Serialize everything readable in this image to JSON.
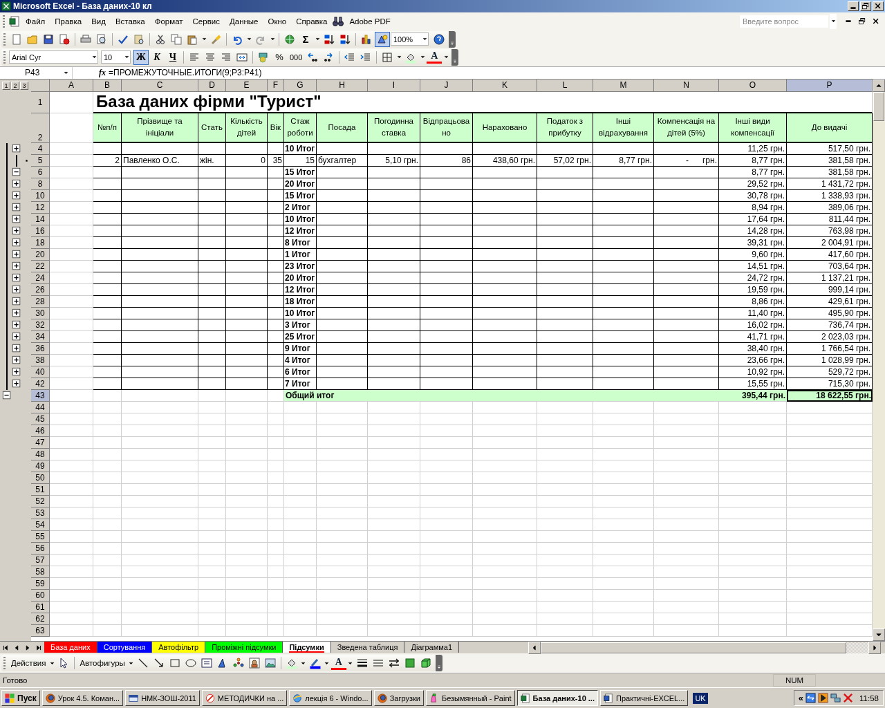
{
  "window": {
    "title": "Microsoft Excel - База даних-10 кл"
  },
  "menu": {
    "items": [
      "Файл",
      "Правка",
      "Вид",
      "Вставка",
      "Формат",
      "Сервис",
      "Данные",
      "Окно",
      "Справка"
    ],
    "adobe": "Adobe PDF",
    "help_placeholder": "Введите вопрос"
  },
  "toolbar": {
    "sum": "Σ",
    "zoom": "100%",
    "font": "Arial Cyr",
    "size": "10",
    "bold": "Ж",
    "italic": "К",
    "underline": "Ч",
    "bold_on": true,
    "percent": "%",
    "thousands": "000",
    "font_color": "A"
  },
  "formula_bar": {
    "name_box": "P43",
    "fx": "fx",
    "formula": "=ПРОМЕЖУТОЧНЫЕ.ИТОГИ(9;P3:P41)"
  },
  "sheet": {
    "outline_levels": [
      "1",
      "2",
      "3"
    ],
    "columns": [
      {
        "label": "A",
        "selected": false
      },
      {
        "label": "B",
        "selected": false
      },
      {
        "label": "C",
        "selected": false
      },
      {
        "label": "D",
        "selected": false
      },
      {
        "label": "E",
        "selected": false
      },
      {
        "label": "F",
        "selected": false
      },
      {
        "label": "G",
        "selected": false
      },
      {
        "label": "H",
        "selected": false
      },
      {
        "label": "I",
        "selected": false
      },
      {
        "label": "J",
        "selected": false
      },
      {
        "label": "K",
        "selected": false
      },
      {
        "label": "L",
        "selected": false
      },
      {
        "label": "M",
        "selected": false
      },
      {
        "label": "N",
        "selected": false
      },
      {
        "label": "O",
        "selected": false
      },
      {
        "label": "P",
        "selected": true
      }
    ],
    "rows": [
      {
        "label": "1",
        "kind": "title",
        "selected": false,
        "title": "База даних фірми \"Турист\""
      },
      {
        "label": "2",
        "kind": "header",
        "selected": false,
        "cells": [
          "№п/п",
          "Прізвище та ініціали",
          "Стать",
          "Кількість дітей",
          "Вік",
          "Стаж роботи",
          "Посада",
          "Погодинна ставка",
          "Відпрацьовано",
          "Нараховано",
          "Податок з прибутку",
          "Інші відрахування",
          "Компенсація на дітей (5%)",
          "Інші види компенсації",
          "До видачі"
        ]
      },
      {
        "label": "4",
        "kind": "subtotal",
        "selected": false,
        "expanded": false,
        "group": "10 Итог",
        "compensation": "11,25 грн.",
        "payout": "517,50 грн."
      },
      {
        "label": "5",
        "kind": "data",
        "selected": false,
        "cells": [
          "2",
          "Павленко О.С.",
          "жін.",
          "0",
          "35",
          "15",
          "бухгалтер",
          "5,10 грн.",
          "86",
          "438,60 грн.",
          "57,02 грн.",
          "8,77 грн.",
          "-      грн.",
          "8,77 грн.",
          "381,58 грн."
        ]
      },
      {
        "label": "6",
        "kind": "subtotal",
        "selected": false,
        "expanded": true,
        "group": "15 Итог",
        "compensation": "8,77 грн.",
        "payout": "381,58 грн."
      },
      {
        "label": "8",
        "kind": "subtotal",
        "selected": false,
        "expanded": false,
        "group": "20 Итог",
        "compensation": "29,52 грн.",
        "payout": "1 431,72 грн."
      },
      {
        "label": "10",
        "kind": "subtotal",
        "selected": false,
        "expanded": false,
        "group": "15 Итог",
        "compensation": "30,78 грн.",
        "payout": "1 338,93 грн."
      },
      {
        "label": "12",
        "kind": "subtotal",
        "selected": false,
        "expanded": false,
        "group": "2 Итог",
        "compensation": "8,94 грн.",
        "payout": "389,06 грн."
      },
      {
        "label": "14",
        "kind": "subtotal",
        "selected": false,
        "expanded": false,
        "group": "10 Итог",
        "compensation": "17,64 грн.",
        "payout": "811,44 грн."
      },
      {
        "label": "16",
        "kind": "subtotal",
        "selected": false,
        "expanded": false,
        "group": "12 Итог",
        "compensation": "14,28 грн.",
        "payout": "763,98 грн."
      },
      {
        "label": "18",
        "kind": "subtotal",
        "selected": false,
        "expanded": false,
        "group": "8 Итог",
        "compensation": "39,31 грн.",
        "payout": "2 004,91 грн."
      },
      {
        "label": "20",
        "kind": "subtotal",
        "selected": false,
        "expanded": false,
        "group": "1 Итог",
        "compensation": "9,60 грн.",
        "payout": "417,60 грн."
      },
      {
        "label": "22",
        "kind": "subtotal",
        "selected": false,
        "expanded": false,
        "group": "23 Итог",
        "compensation": "14,51 грн.",
        "payout": "703,64 грн."
      },
      {
        "label": "24",
        "kind": "subtotal",
        "selected": false,
        "expanded": false,
        "group": "20 Итог",
        "compensation": "24,72 грн.",
        "payout": "1 137,21 грн."
      },
      {
        "label": "26",
        "kind": "subtotal",
        "selected": false,
        "expanded": false,
        "group": "12 Итог",
        "compensation": "19,59 грн.",
        "payout": "999,14 грн."
      },
      {
        "label": "28",
        "kind": "subtotal",
        "selected": false,
        "expanded": false,
        "group": "18 Итог",
        "compensation": "8,86 грн.",
        "payout": "429,61 грн."
      },
      {
        "label": "30",
        "kind": "subtotal",
        "selected": false,
        "expanded": false,
        "group": "10 Итог",
        "compensation": "11,40 грн.",
        "payout": "495,90 грн."
      },
      {
        "label": "32",
        "kind": "subtotal",
        "selected": false,
        "expanded": false,
        "group": "3 Итог",
        "compensation": "16,02 грн.",
        "payout": "736,74 грн."
      },
      {
        "label": "34",
        "kind": "subtotal",
        "selected": false,
        "expanded": false,
        "group": "25 Итог",
        "compensation": "41,71 грн.",
        "payout": "2 023,03 грн."
      },
      {
        "label": "36",
        "kind": "subtotal",
        "selected": false,
        "expanded": false,
        "group": "9 Итог",
        "compensation": "38,40 грн.",
        "payout": "1 766,54 грн."
      },
      {
        "label": "38",
        "kind": "subtotal",
        "selected": false,
        "expanded": false,
        "group": "4 Итог",
        "compensation": "23,66 грн.",
        "payout": "1 028,99 грн."
      },
      {
        "label": "40",
        "kind": "subtotal",
        "selected": false,
        "expanded": false,
        "group": "6 Итог",
        "compensation": "10,92 грн.",
        "payout": "529,72 грн."
      },
      {
        "label": "42",
        "kind": "subtotal",
        "selected": false,
        "expanded": false,
        "group": "7 Итог",
        "compensation": "15,55 грн.",
        "payout": "715,30 грн."
      },
      {
        "label": "43",
        "kind": "grand",
        "selected": true,
        "expanded": true,
        "group": "Общий итог",
        "compensation": "395,44 грн.",
        "payout": "18 622,55 грн."
      },
      {
        "label": "44",
        "kind": "empty",
        "selected": false
      },
      {
        "label": "45",
        "kind": "empty",
        "selected": false
      },
      {
        "label": "46",
        "kind": "empty",
        "selected": false
      },
      {
        "label": "47",
        "kind": "empty",
        "selected": false
      },
      {
        "label": "48",
        "kind": "empty",
        "selected": false
      },
      {
        "label": "49",
        "kind": "empty",
        "selected": false
      },
      {
        "label": "50",
        "kind": "empty",
        "selected": false
      },
      {
        "label": "51",
        "kind": "empty",
        "selected": false
      },
      {
        "label": "52",
        "kind": "empty",
        "selected": false
      },
      {
        "label": "53",
        "kind": "empty",
        "selected": false
      },
      {
        "label": "54",
        "kind": "empty",
        "selected": false
      },
      {
        "label": "55",
        "kind": "empty",
        "selected": false
      },
      {
        "label": "56",
        "kind": "empty",
        "selected": false
      },
      {
        "label": "57",
        "kind": "empty",
        "selected": false
      },
      {
        "label": "58",
        "kind": "empty",
        "selected": false
      },
      {
        "label": "59",
        "kind": "empty",
        "selected": false
      },
      {
        "label": "60",
        "kind": "empty",
        "selected": false
      },
      {
        "label": "61",
        "kind": "empty",
        "selected": false
      },
      {
        "label": "62",
        "kind": "empty",
        "selected": false
      },
      {
        "label": "63",
        "kind": "empty",
        "selected": false
      }
    ],
    "tabs": [
      {
        "label": "База даних",
        "color": "#ff0000",
        "selected": false
      },
      {
        "label": "Сортування",
        "color": "#0000ff",
        "selected": false
      },
      {
        "label": "Автофільтр",
        "color": "#ffff00",
        "selected": false
      },
      {
        "label": "Проміжні підсумки",
        "color": "#00ff00",
        "selected": false
      },
      {
        "label": "Підсумки",
        "color": "#ff0000",
        "selected": true
      },
      {
        "label": "Зведена таблиця",
        "selected": false
      },
      {
        "label": "Діаграмма1",
        "selected": false
      }
    ]
  },
  "drawing_toolbar": {
    "actions": "Действия",
    "autoshapes": "Автофигуры",
    "font_color": "A"
  },
  "status_bar": {
    "text": "Готово",
    "num": "NUM"
  },
  "taskbar": {
    "start": "Пуск",
    "tasks": [
      {
        "label": "Урок 4.5. Коман...",
        "selected": false
      },
      {
        "label": "НМК-ЗОШ-2011",
        "selected": false
      },
      {
        "label": "МЕТОДИЧКИ на ...",
        "selected": false
      },
      {
        "label": "лекція 6 - Windo...",
        "selected": false
      },
      {
        "label": "Загрузки",
        "selected": false
      },
      {
        "label": "Безымянный - Paint",
        "selected": false
      },
      {
        "label": "База даних-10 ...",
        "selected": true
      },
      {
        "label": "Практичні-EXCEL...",
        "selected": false
      }
    ],
    "language": "UK",
    "tray_expand": "«",
    "clock": "11:58"
  }
}
